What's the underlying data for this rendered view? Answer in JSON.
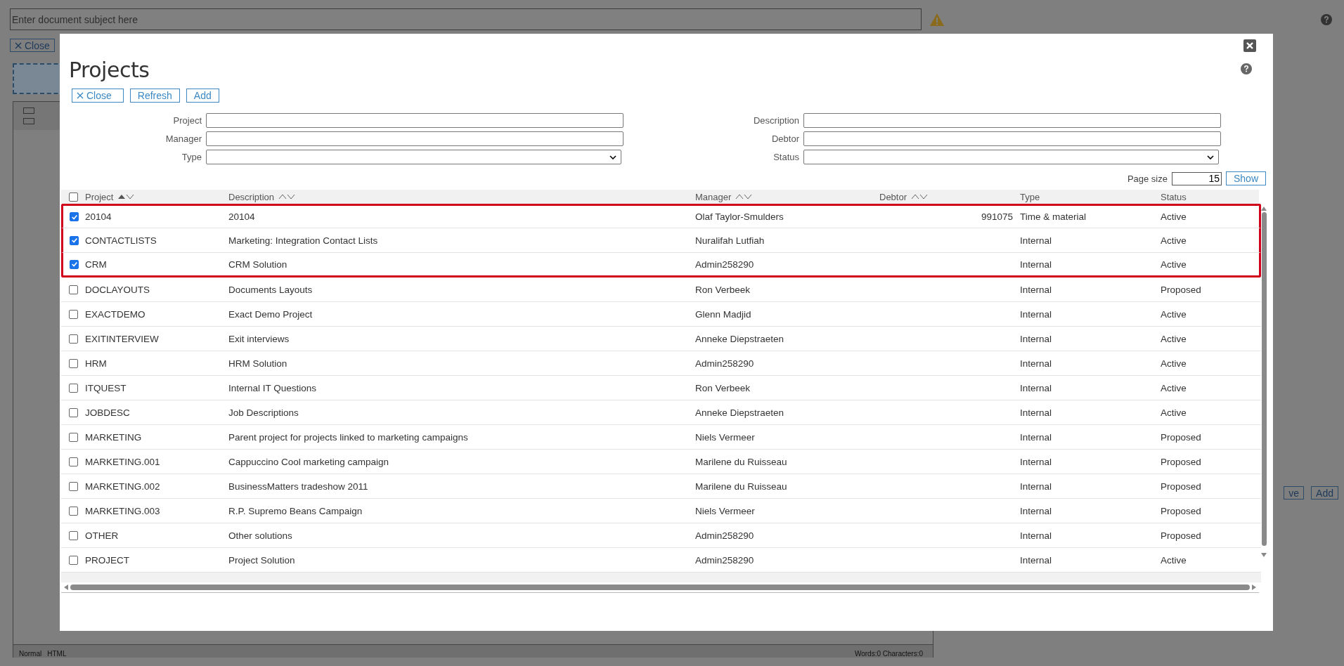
{
  "background": {
    "subject": {
      "placeholder": "Enter document subject here"
    },
    "close_button": "Close",
    "side_buttons": [
      "ve",
      "Add"
    ],
    "editor_modes": [
      "Normal",
      "HTML"
    ],
    "word_count": "Words:0 Characters:0"
  },
  "dialog": {
    "title": "Projects",
    "buttons": [
      {
        "label": "Close",
        "kind": "close"
      },
      {
        "label": "Refresh",
        "kind": "plain"
      },
      {
        "label": "Add",
        "kind": "plain"
      }
    ],
    "filters_left": [
      {
        "label": "Project",
        "kind": "text"
      },
      {
        "label": "Manager",
        "kind": "text"
      },
      {
        "label": "Type",
        "kind": "select"
      }
    ],
    "filters_right": [
      {
        "label": "Description",
        "kind": "text"
      },
      {
        "label": "Debtor",
        "kind": "text"
      },
      {
        "label": "Status",
        "kind": "select"
      }
    ],
    "page_size": {
      "label": "Page size",
      "value": "15",
      "button": "Show"
    },
    "table": {
      "all_checked": false,
      "columns": [
        {
          "label": "Project",
          "sortable": true,
          "sorted_ascending": true
        },
        {
          "label": "Description",
          "sortable": true,
          "sorted_ascending": false
        },
        {
          "label": "Manager",
          "sortable": true,
          "sorted_ascending": false
        },
        {
          "label": "Debtor",
          "sortable": true,
          "sorted_ascending": false
        },
        {
          "label": "Type",
          "sortable": false
        },
        {
          "label": "Status",
          "sortable": false
        }
      ],
      "rows": [
        {
          "checked": true,
          "highlighted": true,
          "project": "20104",
          "description": "20104",
          "manager": "Olaf Taylor-Smulders",
          "debtor": "991075",
          "type": "Time & material",
          "status": "Active"
        },
        {
          "checked": true,
          "highlighted": true,
          "project": "CONTACTLISTS",
          "description": "Marketing: Integration Contact Lists",
          "manager": "Nuralifah Lutfiah",
          "type": "Internal",
          "status": "Active"
        },
        {
          "checked": true,
          "highlighted": true,
          "project": "CRM",
          "description": "CRM Solution",
          "manager": "Admin258290",
          "type": "Internal",
          "status": "Active"
        },
        {
          "checked": false,
          "highlighted": false,
          "project": "DOCLAYOUTS",
          "description": "Documents Layouts",
          "manager": "Ron Verbeek",
          "type": "Internal",
          "status": "Proposed"
        },
        {
          "checked": false,
          "highlighted": false,
          "project": "EXACTDEMO",
          "description": "Exact Demo Project",
          "manager": "Glenn Madjid",
          "type": "Internal",
          "status": "Active"
        },
        {
          "checked": false,
          "highlighted": false,
          "project": "EXITINTERVIEW",
          "description": "Exit interviews",
          "manager": "Anneke Diepstraeten",
          "type": "Internal",
          "status": "Active"
        },
        {
          "checked": false,
          "highlighted": false,
          "project": "HRM",
          "description": "HRM Solution",
          "manager": "Admin258290",
          "type": "Internal",
          "status": "Active"
        },
        {
          "checked": false,
          "highlighted": false,
          "project": "ITQUEST",
          "description": "Internal IT Questions",
          "manager": "Ron Verbeek",
          "type": "Internal",
          "status": "Active"
        },
        {
          "checked": false,
          "highlighted": false,
          "project": "JOBDESC",
          "description": "Job Descriptions",
          "manager": "Anneke Diepstraeten",
          "type": "Internal",
          "status": "Active"
        },
        {
          "checked": false,
          "highlighted": false,
          "project": "MARKETING",
          "description": "Parent project for projects linked to marketing campaigns",
          "manager": "Niels Vermeer",
          "type": "Internal",
          "status": "Proposed"
        },
        {
          "checked": false,
          "highlighted": false,
          "project": "MARKETING.001",
          "description": "Cappuccino Cool marketing campaign",
          "manager": "Marilene du Ruisseau",
          "type": "Internal",
          "status": "Proposed"
        },
        {
          "checked": false,
          "highlighted": false,
          "project": "MARKETING.002",
          "description": "BusinessMatters tradeshow 2011",
          "manager": "Marilene du Ruisseau",
          "type": "Internal",
          "status": "Proposed"
        },
        {
          "checked": false,
          "highlighted": false,
          "project": "MARKETING.003",
          "description": "R.P. Supremo Beans Campaign",
          "manager": "Niels Vermeer",
          "type": "Internal",
          "status": "Proposed"
        },
        {
          "checked": false,
          "highlighted": false,
          "project": "OTHER",
          "description": "Other solutions",
          "manager": "Admin258290",
          "type": "Internal",
          "status": "Proposed"
        },
        {
          "checked": false,
          "highlighted": false,
          "project": "PROJECT",
          "description": "Project Solution",
          "manager": "Admin258290",
          "type": "Internal",
          "status": "Active"
        }
      ]
    }
  }
}
